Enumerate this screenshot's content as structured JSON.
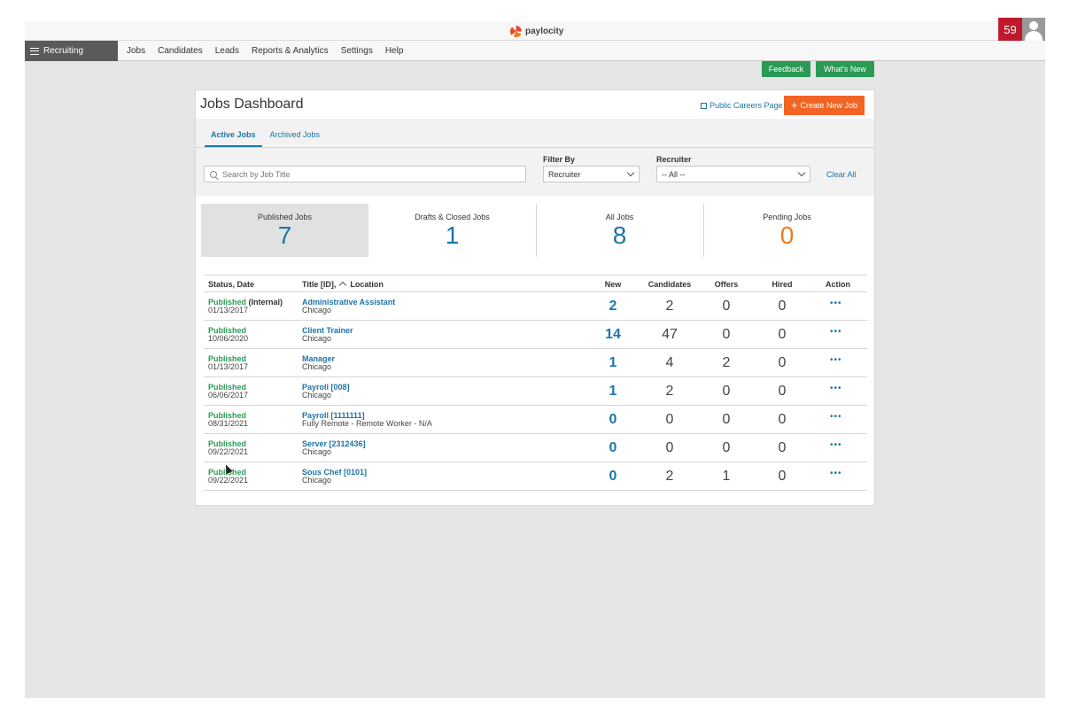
{
  "brand": {
    "name": "paylocity"
  },
  "nav": {
    "module": "Recruiting",
    "items": [
      "Jobs",
      "Candidates",
      "Leads",
      "Reports & Analytics",
      "Settings",
      "Help"
    ]
  },
  "header_buttons": {
    "feedback": "Feedback",
    "whats_new": "What's New"
  },
  "user": {
    "notification_count": "59"
  },
  "dashboard": {
    "title": "Jobs Dashboard",
    "careers_link": "Public Careers Page",
    "create_button": "Create New Job",
    "tabs": [
      "Active Jobs",
      "Archived Jobs"
    ],
    "search_placeholder": "Search by Job Title",
    "filter_by_label": "Filter By",
    "filter_by_value": "Recruiter",
    "recruiter_label": "Recruiter",
    "recruiter_value": "-- All --",
    "clear_all": "Clear All"
  },
  "stats": [
    {
      "label": "Published Jobs",
      "value": "7",
      "color": "#1b75a8"
    },
    {
      "label": "Drafts & Closed Jobs",
      "value": "1",
      "color": "#1b75a8"
    },
    {
      "label": "All Jobs",
      "value": "8",
      "color": "#1b75a8"
    },
    {
      "label": "Pending Jobs",
      "value": "0",
      "color": "#f07a1a"
    }
  ],
  "table": {
    "headers": {
      "status": "Status, Date",
      "title": "Title [ID],",
      "location": "Location",
      "new": "New",
      "candidates": "Candidates",
      "offers": "Offers",
      "hired": "Hired",
      "action": "Action"
    },
    "rows": [
      {
        "status": "Published",
        "note": " (Internal)",
        "date": "01/13/2017",
        "title": "Administrative Assistant",
        "location": "Chicago",
        "new": "2",
        "candidates": "2",
        "offers": "0",
        "hired": "0"
      },
      {
        "status": "Published",
        "note": "",
        "date": "10/06/2020",
        "title": "Client Trainer",
        "location": "Chicago",
        "new": "14",
        "candidates": "47",
        "offers": "0",
        "hired": "0"
      },
      {
        "status": "Published",
        "note": "",
        "date": "01/13/2017",
        "title": "Manager",
        "location": "Chicago",
        "new": "1",
        "candidates": "4",
        "offers": "2",
        "hired": "0"
      },
      {
        "status": "Published",
        "note": "",
        "date": "06/06/2017",
        "title": "Payroll [008]",
        "location": "Chicago",
        "new": "1",
        "candidates": "2",
        "offers": "0",
        "hired": "0"
      },
      {
        "status": "Published",
        "note": "",
        "date": "08/31/2021",
        "title": "Payroll [1111111]",
        "location": "Fully Remote - Remote Worker - N/A",
        "new": "0",
        "candidates": "0",
        "offers": "0",
        "hired": "0"
      },
      {
        "status": "Published",
        "note": "",
        "date": "09/22/2021",
        "title": "Server [2312436]",
        "location": "Chicago",
        "new": "0",
        "candidates": "0",
        "offers": "0",
        "hired": "0"
      },
      {
        "status": "Published",
        "note": "",
        "date": "09/22/2021",
        "title": "Sous Chef [0101]",
        "location": "Chicago",
        "new": "0",
        "candidates": "2",
        "offers": "1",
        "hired": "0"
      }
    ]
  }
}
